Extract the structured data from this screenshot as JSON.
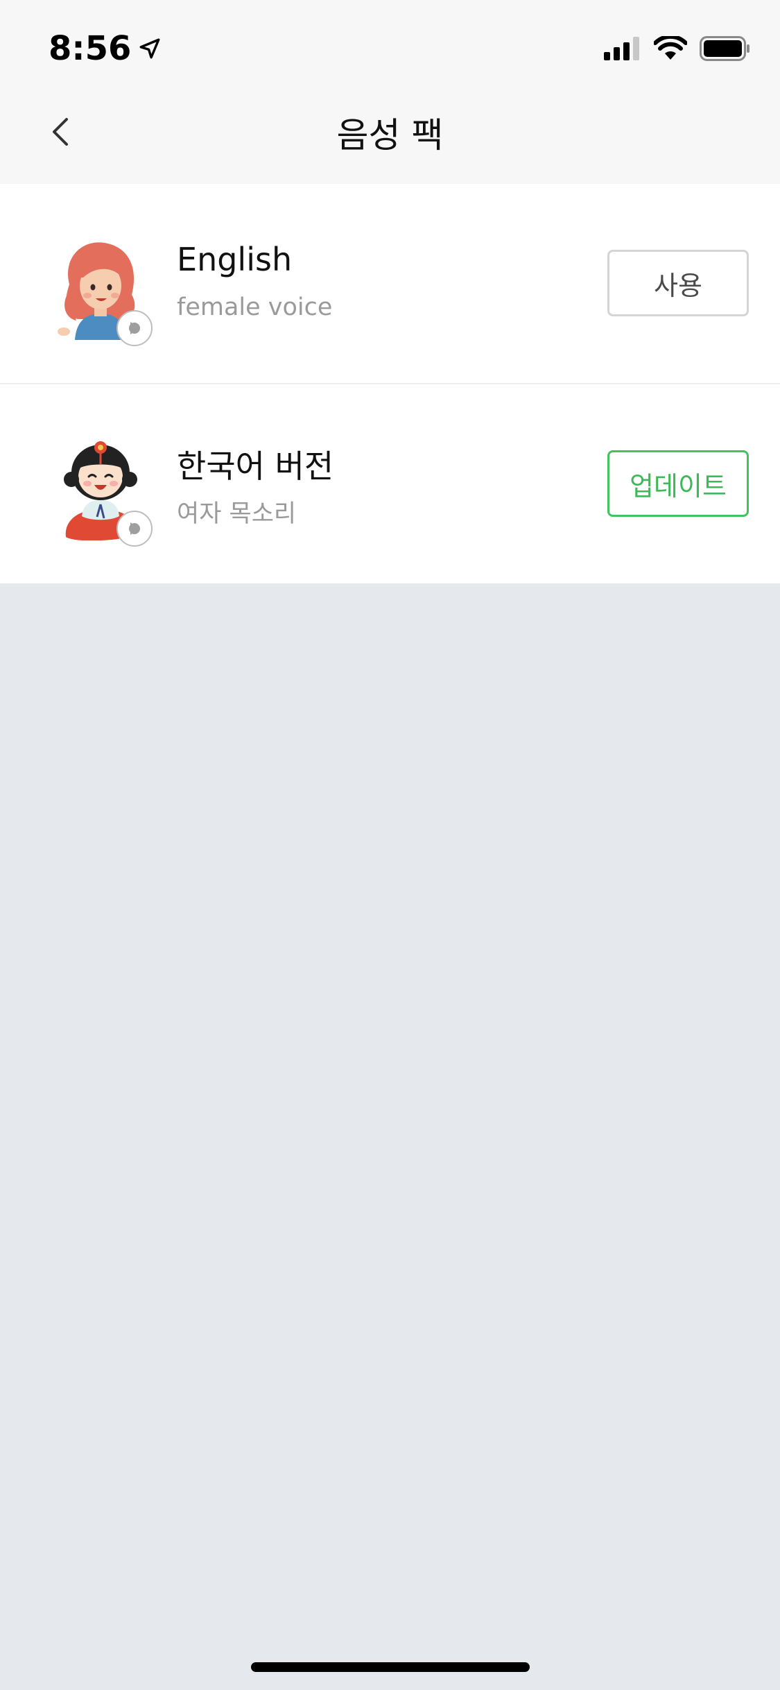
{
  "status_bar": {
    "time": "8:56",
    "icons": [
      "location-arrow-icon",
      "cellular-signal-icon",
      "wifi-icon",
      "battery-icon"
    ]
  },
  "nav": {
    "back_icon": "chevron-left-icon",
    "title": "음성 팩"
  },
  "voice_packs": [
    {
      "title": "English",
      "subtitle": "female voice",
      "avatar": "red-haired-girl-avatar",
      "play_icon": "play-icon",
      "action_label": "사용",
      "action_style": "default"
    },
    {
      "title": "한국어 버전",
      "subtitle": "여자 목소리",
      "avatar": "hanbok-girl-avatar",
      "play_icon": "play-icon",
      "action_label": "업데이트",
      "action_style": "update"
    }
  ],
  "colors": {
    "header_bg": "#f7f7f7",
    "page_bg": "#e5e8ed",
    "update_green": "#3dba57",
    "neutral_border": "#d5d5d5"
  }
}
